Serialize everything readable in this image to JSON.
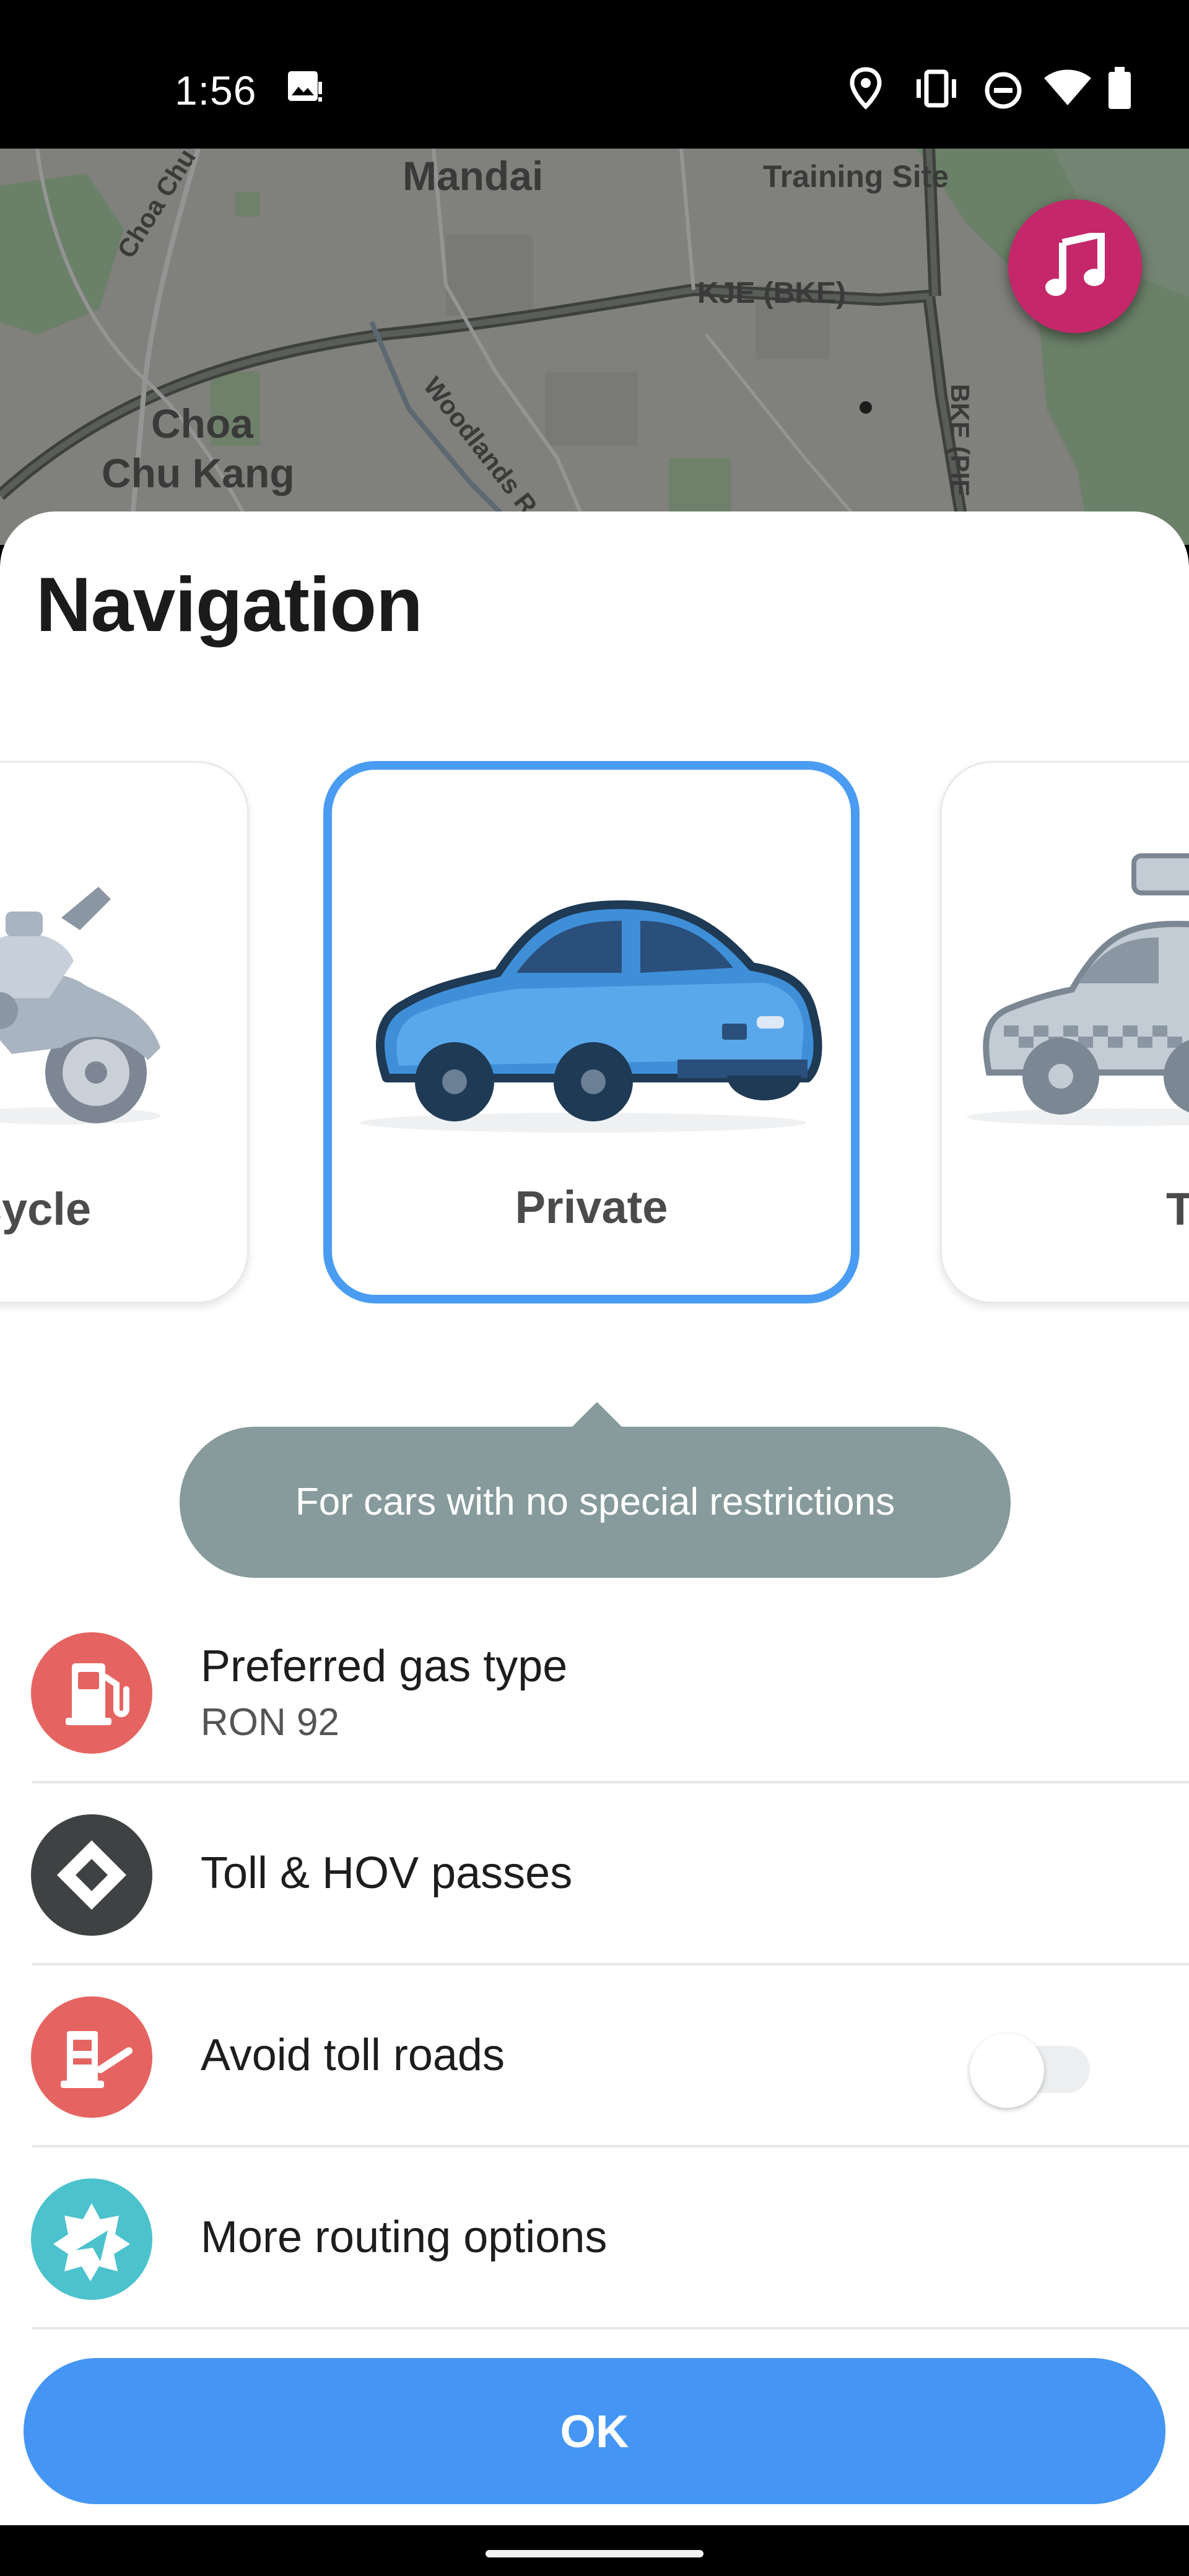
{
  "status_bar": {
    "time": "1:56",
    "icons": [
      "image-icon",
      "location-icon",
      "vibrate-icon",
      "dnd-icon",
      "wifi-icon",
      "battery-icon"
    ]
  },
  "map": {
    "labels": {
      "mandai": "Mandai",
      "training_site": "Training Site",
      "kje": "KJE (BKE)",
      "choa_chu_road": "Choa Chu K",
      "choa": "Choa",
      "chu_kang": "Chu Kang",
      "woodlands": "Woodlands R",
      "bke": "BKE (PIE"
    },
    "music_button_icon": "music-note-icon"
  },
  "sheet": {
    "title": "Navigation"
  },
  "vehicle_types": [
    {
      "label": "cycle",
      "icon": "motorcycle-icon",
      "selected": false
    },
    {
      "label": "Private",
      "icon": "car-icon",
      "selected": true
    },
    {
      "label": "T",
      "icon": "taxi-icon",
      "selected": false
    }
  ],
  "tooltip": {
    "text": "For cars with no special restrictions"
  },
  "settings": [
    {
      "title": "Preferred gas type",
      "subtitle": "RON 92",
      "icon": "gas-pump-icon",
      "color": "#e56461"
    },
    {
      "title": "Toll & HOV passes",
      "icon": "diamond-icon",
      "color": "#3f4242"
    },
    {
      "title": "Avoid toll roads",
      "icon": "toll-gate-icon",
      "color": "#e56461",
      "toggle_on": false
    },
    {
      "title": "More routing options",
      "icon": "routing-icon",
      "color": "#4cc2cc"
    }
  ],
  "ok_button": {
    "label": "OK"
  },
  "colors": {
    "accent": "#4596f4",
    "tooltip": "#879b9c",
    "music": "#c4286a"
  }
}
